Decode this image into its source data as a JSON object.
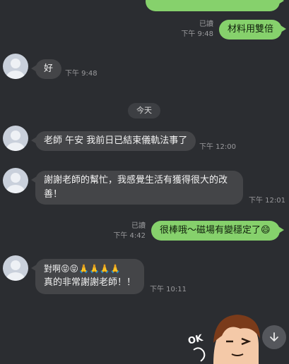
{
  "messages": {
    "m1": {
      "text": "材料用雙倍",
      "read": "已讀",
      "time": "下午 9:48"
    },
    "m2": {
      "text": "好",
      "time": "下午 9:48"
    },
    "date_divider": "今天",
    "m3": {
      "text": "老師 午安 我前日已結束儀軌法事了",
      "time": "下午 12:00"
    },
    "m4": {
      "line1": "謝謝老師的幫忙，我感覺生活有獲得很大的改",
      "line2": "善！",
      "time": "下午 12:01"
    },
    "m5": {
      "text": "很棒哦～磁場有變穩定了😄",
      "read": "已讀",
      "time": "下午 4:42"
    },
    "m6": {
      "line1": "對啊😝😝🙏🙏🙏🙏",
      "line2": "真的非常謝謝老師！！",
      "time": "下午 10:11"
    }
  },
  "sticker_text": "OK",
  "colors": {
    "outgoing": "#86d16c",
    "incoming": "#444548",
    "background": "#2b2d31"
  },
  "icons": {
    "scroll": "arrow-down-icon",
    "avatar": "default-avatar-icon"
  }
}
